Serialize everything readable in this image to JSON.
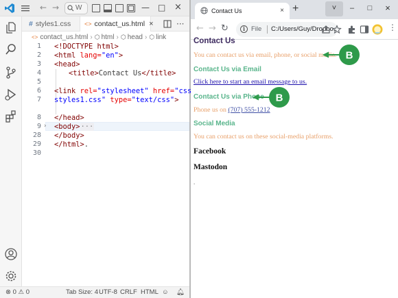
{
  "vscode": {
    "search_text": "W",
    "tabs": [
      {
        "label": "styles1.css",
        "icon": "hash-icon"
      },
      {
        "label": "contact_us.html",
        "icon": "html-icon",
        "close": "×"
      }
    ],
    "tab_actions": [
      "split-editor-icon",
      "more-icon"
    ],
    "more_label": "···",
    "breadcrumb": [
      "contact_us.html",
      "html",
      "head",
      "link"
    ],
    "lines": [
      {
        "num": "1"
      },
      {
        "num": "2"
      },
      {
        "num": "3"
      },
      {
        "num": "4"
      },
      {
        "num": "5"
      },
      {
        "num": "6"
      },
      {
        "num": "7"
      },
      {
        "num": "8"
      },
      {
        "num": "9"
      },
      {
        "num": "28"
      },
      {
        "num": "29"
      },
      {
        "num": "30"
      }
    ],
    "code": {
      "l1": "<!DOCTYPE html>",
      "l2_tag": "<html",
      "l2_attr": " lang=",
      "l2_val": "\"en\"",
      "l2_end": ">",
      "l3": "<head>",
      "l4_open": "<title>",
      "l4_text": "Contact Us",
      "l4_close": "</title>",
      "l6_tag": "<link",
      "l6_attr1": " rel=",
      "l6_val1": "\"stylesheet\"",
      "l6_attr2": " href=",
      "l6_val2a": "\"css/",
      "l6b_val2b": "styles1.css\"",
      "l6b_attr3": " type=",
      "l6b_val3": "\"text/css\"",
      "l6b_end": ">",
      "l8": "</head>",
      "l9": "<body>",
      "l9_ellipsis": "···",
      "l28": "</body>",
      "l29_tag": "</html>",
      "l29_dot": "."
    },
    "status": {
      "errors": "0",
      "warnings": "0",
      "tab_size": "Tab Size: 4",
      "encoding": "UTF-8",
      "eol": "CRLF",
      "language": "HTML"
    }
  },
  "chrome": {
    "tab_title": "Contact Us",
    "tab_close": "×",
    "new_tab": "+",
    "window_buttons": [
      "˅",
      "–",
      "□",
      "×"
    ],
    "omnibox_label": "File",
    "omnibox_url": "C:/Users/Guy/Dropbo...",
    "page": {
      "h1": "Contact Us",
      "intro": "You can contact us via email, phone, or social media.",
      "h2_email": "Contact Us via Email",
      "email_link": "Click here to start an email message to us.",
      "h2_phone": "Contact Us via Phone",
      "phone_prefix": "Phone us on ",
      "phone_number": "(707) 555-1212",
      "h2_social": "Social Media",
      "social_text": "You can contact us on these social-media platforms.",
      "h3_facebook": "Facebook",
      "h3_mastodon": "Mastodon",
      "trailing_dot": "."
    }
  },
  "callouts": [
    {
      "label": "B",
      "color": "#2e9a4a"
    },
    {
      "label": "B",
      "color": "#2e9a4a"
    }
  ]
}
